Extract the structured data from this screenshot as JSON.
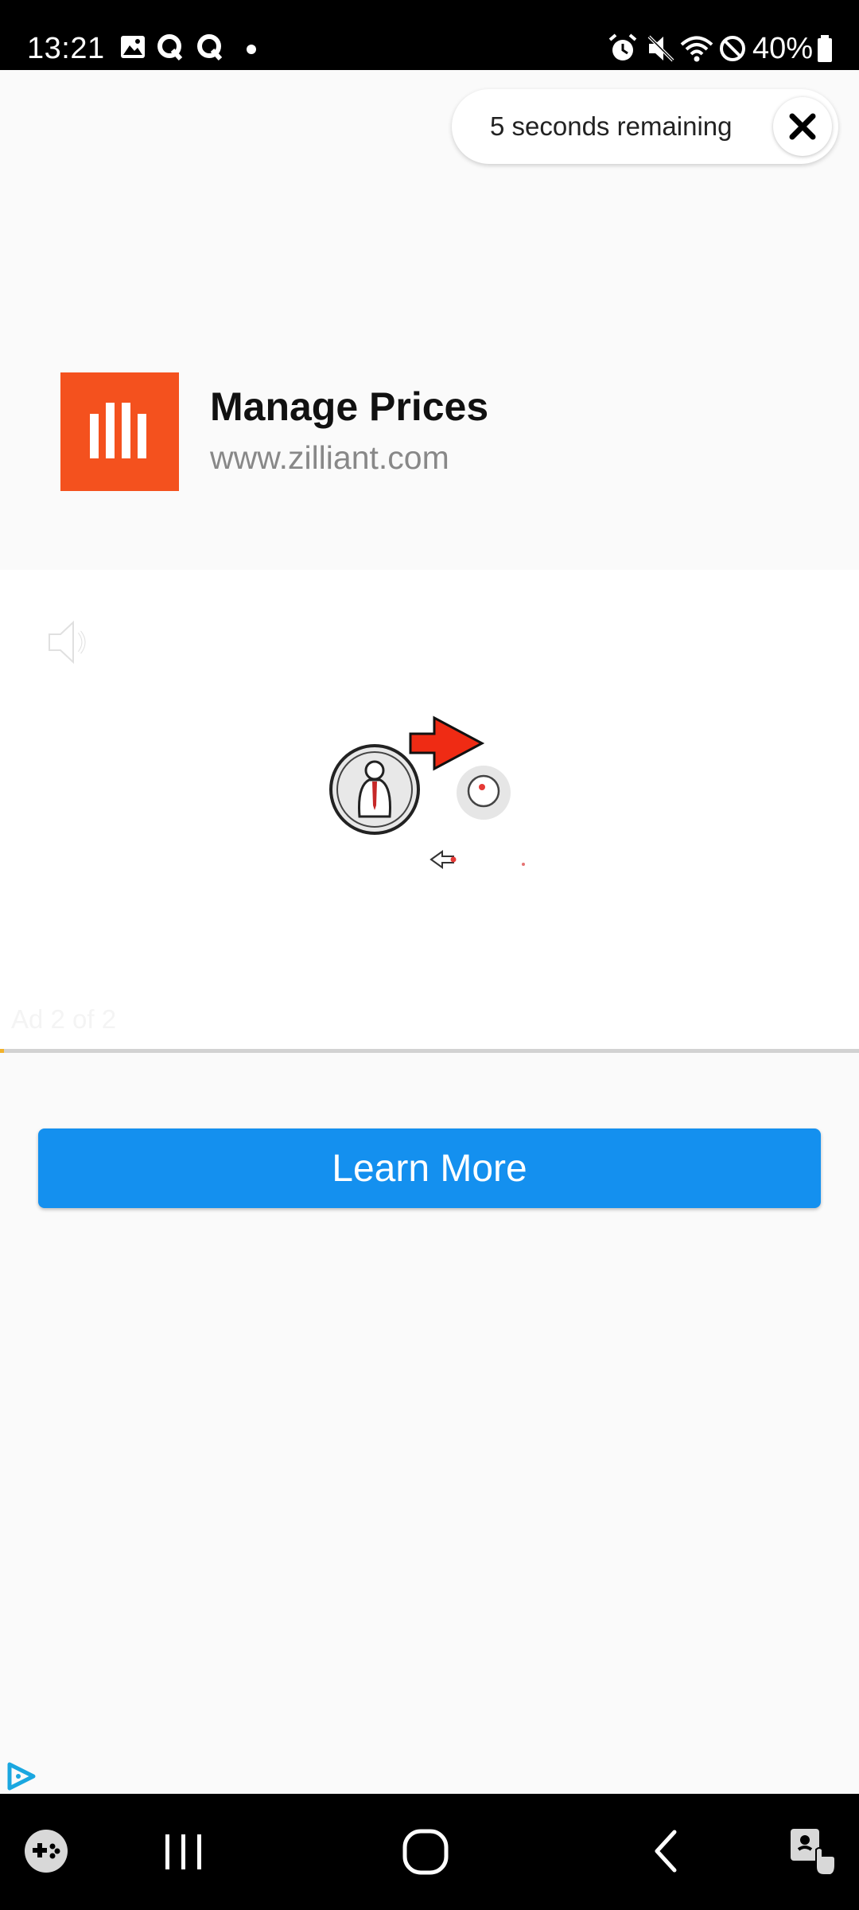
{
  "status_bar": {
    "time": "13:21",
    "battery": "40%",
    "left_icons": [
      "gallery-icon",
      "q-app-icon",
      "q-app-icon",
      "dot-icon"
    ],
    "right_icons": [
      "alarm-icon",
      "mute-icon",
      "wifi-icon",
      "do-not-disturb-icon",
      "battery-icon"
    ]
  },
  "ad_timer": {
    "text": "5 seconds remaining",
    "close_icon": "close-icon"
  },
  "advertiser": {
    "title": "Manage Prices",
    "url": "www.zilliant.com",
    "logo_color": "#f4511e"
  },
  "video": {
    "ad_counter": "Ad 2 of 2",
    "sound_icon": "speaker-icon",
    "progress": 0.005,
    "progress_color": "#f2b22a"
  },
  "cta": {
    "label": "Learn More",
    "color": "#1490ef"
  },
  "nav_bar": {
    "items": [
      "game-launcher-icon",
      "recent-apps-icon",
      "home-icon",
      "back-icon",
      "accessibility-icon"
    ]
  }
}
